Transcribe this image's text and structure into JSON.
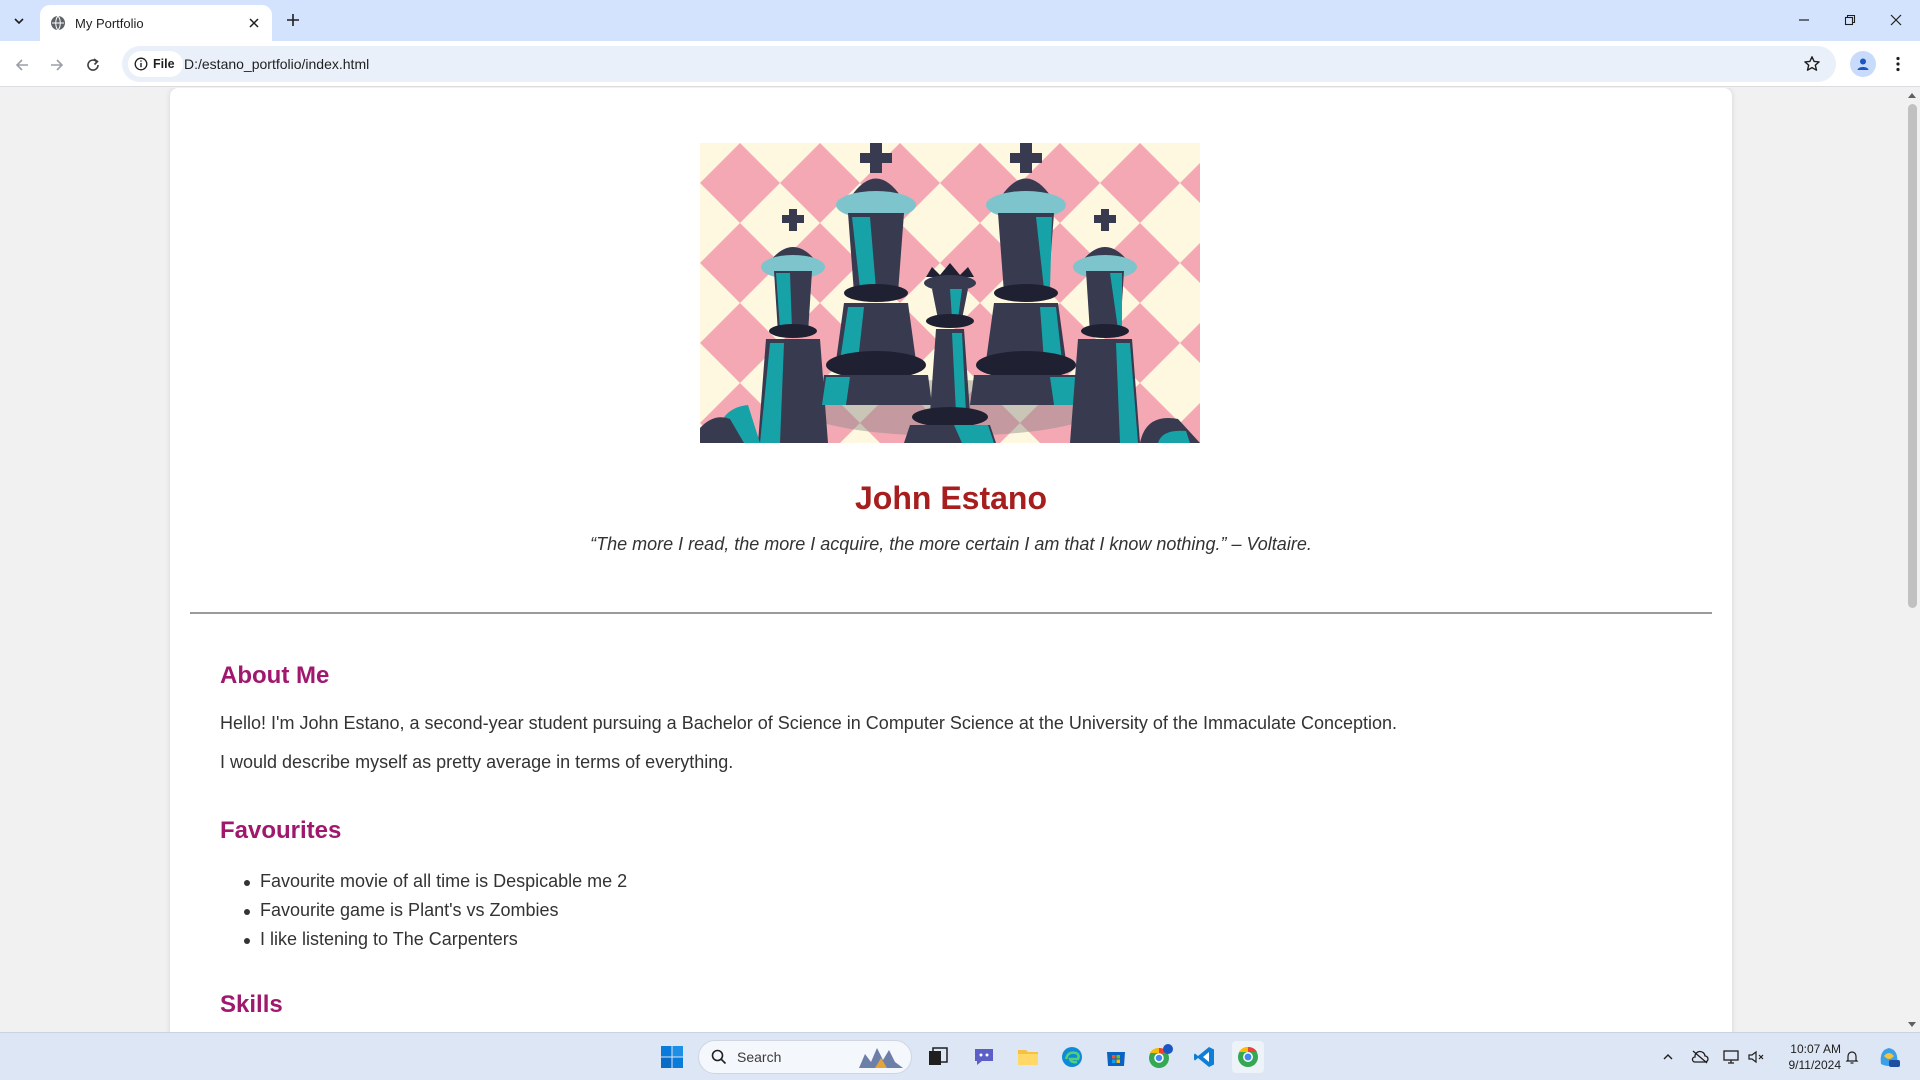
{
  "browser": {
    "tab_title": "My Portfolio",
    "chip_label": "File",
    "url": "D:/estano_portfolio/index.html"
  },
  "page": {
    "name": "John Estano",
    "quote": "“The more I read, the more I acquire, the more certain I am that I know nothing.” – Voltaire.",
    "about": {
      "heading": "About Me",
      "p1": "Hello! I'm John Estano, a second-year student pursuing a Bachelor of Science in Computer Science at the University of the Immaculate Conception.",
      "p2": "I would describe myself as pretty average in terms of everything."
    },
    "favourites": {
      "heading": "Favourites",
      "items": [
        "Favourite movie of all time is Despicable me 2",
        "Favourite game is Plant's vs Zombies",
        "I like listening to The Carpenters"
      ]
    },
    "skills": {
      "heading": "Skills"
    }
  },
  "taskbar": {
    "search_placeholder": "Search",
    "time": "10:07 AM",
    "date": "9/11/2024"
  },
  "colors": {
    "name": "#a61e1e",
    "heading": "#a0186e",
    "tabstrip": "#d3e3fd",
    "chess_teal": "#17a2a8",
    "chess_dark": "#383a4f",
    "board_pink": "#f4a8b3",
    "board_cream": "#fdf8df"
  }
}
